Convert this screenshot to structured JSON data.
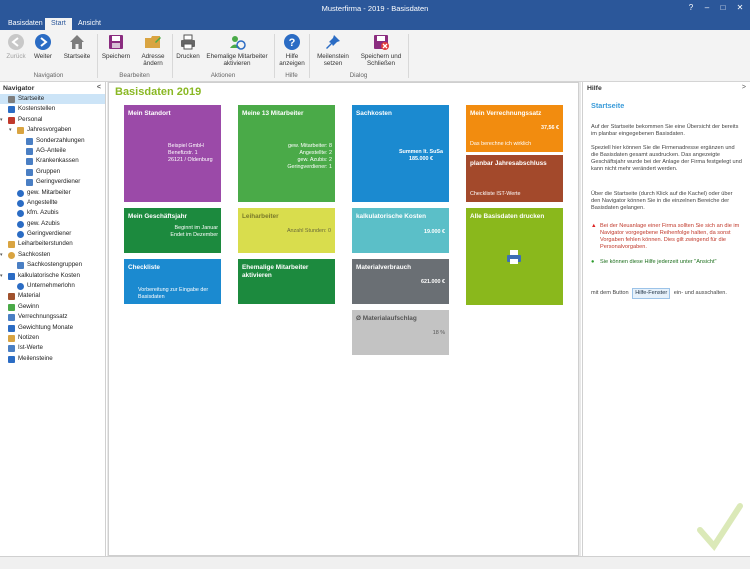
{
  "window": {
    "title": "Musterfirma - 2019 - Basisdaten",
    "help_btn": "?",
    "minimize": "–",
    "maximize": "□",
    "close": "✕"
  },
  "tabs": [
    "Basisdaten",
    "Start",
    "Ansicht"
  ],
  "ribbon": {
    "buttons": {
      "back": "Zurück",
      "forward": "Weiter",
      "home": "Startseite",
      "save": "Speichern",
      "address": "Adresse ändern",
      "print": "Drucken",
      "former": "Ehemalige Mitarbeiter aktivieren",
      "help": "Hilfe anzeigen",
      "milestone": "Meilenstein setzen",
      "saveclose": "Speichern und Schließen"
    },
    "groups": {
      "navigation": "Navigation",
      "edit": "Bearbeiten",
      "actions": "Aktionen",
      "help": "Hilfe",
      "dialog": "Dialog"
    }
  },
  "navigator": {
    "title": "Navigator",
    "collapse": "<",
    "items": [
      {
        "label": "Startseite",
        "icon": "home-icon",
        "level": 0,
        "selected": true
      },
      {
        "label": "Kostenstellen",
        "icon": "list-icon",
        "level": 0
      },
      {
        "label": "Personal",
        "icon": "group-icon",
        "level": 0,
        "expanded": true
      },
      {
        "label": "Jahresvorgaben",
        "icon": "folder-icon",
        "level": 1,
        "expanded": true
      },
      {
        "label": "Sonderzahlungen",
        "icon": "doc-icon",
        "level": 2
      },
      {
        "label": "AG-Anteile",
        "icon": "doc-icon",
        "level": 2
      },
      {
        "label": "Krankenkassen",
        "icon": "doc-icon",
        "level": 2
      },
      {
        "label": "Gruppen",
        "icon": "doc-icon",
        "level": 2
      },
      {
        "label": "Geringverdiener",
        "icon": "doc-icon",
        "level": 2
      },
      {
        "label": "gew. Mitarbeiter",
        "icon": "person-icon",
        "level": 1
      },
      {
        "label": "Angestellte",
        "icon": "person-icon",
        "level": 1
      },
      {
        "label": "kfm. Azubis",
        "icon": "person-icon",
        "level": 1
      },
      {
        "label": "gew. Azubis",
        "icon": "person-icon",
        "level": 1
      },
      {
        "label": "Geringverdiener",
        "icon": "person-icon",
        "level": 1
      },
      {
        "label": "Leiharbeiterstunden",
        "icon": "clock-icon",
        "level": 0
      },
      {
        "label": "Sachkosten",
        "icon": "coins-icon",
        "level": 0,
        "expanded": true
      },
      {
        "label": "Sachkostengruppen",
        "icon": "doc-icon",
        "level": 1
      },
      {
        "label": "kalkulatorische Kosten",
        "icon": "calc-icon",
        "level": 0,
        "expanded": true
      },
      {
        "label": "Unternehmerlohn",
        "icon": "person-icon",
        "level": 1
      },
      {
        "label": "Material",
        "icon": "box-icon",
        "level": 0
      },
      {
        "label": "Gewinn",
        "icon": "chart-icon",
        "level": 0
      },
      {
        "label": "Verrechnungssatz",
        "icon": "doc-icon",
        "level": 0
      },
      {
        "label": "Gewichtung Monate",
        "icon": "calendar-icon",
        "level": 0
      },
      {
        "label": "Notizen",
        "icon": "note-icon",
        "level": 0
      },
      {
        "label": "Ist-Werte",
        "icon": "doc-icon",
        "level": 0
      },
      {
        "label": "Meilensteine",
        "icon": "pin-icon",
        "level": 0
      }
    ]
  },
  "main": {
    "title": "Basisdaten 2019",
    "tiles": {
      "standort": {
        "title": "Mein Standort",
        "lines": [
          "Beispiel GmbH",
          "Benefizstr. 1",
          "26121 / Oldenburg"
        ],
        "color": "#9b4aa8"
      },
      "mitarbeiter": {
        "title": "Meine 13 Mitarbeiter",
        "lines": [
          "gew. Mitarbeiter: 8",
          "Angestellte: 2",
          "gew. Azubis: 2",
          "Geringverdiener: 1"
        ],
        "color": "#4aaa48"
      },
      "sachkosten": {
        "title": "Sachkosten",
        "lines": [
          "Summen lt. SuSa",
          "185.000 €"
        ],
        "color": "#1b8ad0"
      },
      "verrechnung": {
        "title": "Mein Verrechnungssatz",
        "value": "37,56 €",
        "note": "Das berechne ich wirklich",
        "color": "#f28c0f"
      },
      "jahresabschluss": {
        "title": "planbar Jahresabschluss",
        "note": "Checkliste IST-Werte",
        "color": "#a3492b"
      },
      "geschaeftsjahr": {
        "title": "Mein Geschäftsjahr",
        "lines": [
          "Beginnt im Januar",
          "Endet im Dezember"
        ],
        "color": "#1c8a3e"
      },
      "leiharbeiter": {
        "title": "Leiharbeiter",
        "value": "Anzahl Stunden: 0",
        "color": "#d9dd4d"
      },
      "kalk": {
        "title": "kalkulatorische Kosten",
        "value": "19.000 €",
        "color": "#5bbfc8"
      },
      "alle": {
        "title": "Alle Basisdaten drucken",
        "color": "#8ab81c"
      },
      "checkliste": {
        "title": "Checkliste",
        "note": "Vorbereitung zur Eingabe der Basisdaten",
        "color": "#1b8ad0"
      },
      "ehemalige": {
        "title": "Ehemalige Mitarbeiter aktivieren",
        "color": "#1c8a3e"
      },
      "material": {
        "title": "Materialverbrauch",
        "value": "621.000 €",
        "color": "#6a6f74"
      },
      "aufschlag": {
        "title": "Ø Materialaufschlag",
        "value": "18 %",
        "color": "#c3c3c3"
      }
    }
  },
  "help": {
    "title": "Hilfe",
    "collapse": ">",
    "heading": "Startseite",
    "p1": "Auf der Startseite bekommen Sie eine Übersicht der bereits im planbar eingegebenen Basisdaten.",
    "p2": "Speziell hier können Sie die Firmenadresse ergänzen und die Basisdaten gesamt ausdrucken. Das angezeigte Geschäftsjahr wurde bei der Anlage der Firma festgelegt und kann nicht mehr verändert werden.",
    "p3": "Über die Startseite (durch Klick auf die Kachel) oder über den Navigator können Sie in die einzelnen Bereiche der Basisdaten gelangen.",
    "warning": "Bei der Neuanlage einer Firma sollten Sie sich an die im Navigator vorgegebene Reihenfolge halten, da sonst Vorgaben fehlen können. Dies gilt zwingend für die Personalvorgaben.",
    "info": "Sie können diese Hilfe jederzeit unter \"Ansicht\"",
    "info2a": "mit dem Button",
    "info_button": "Hilfe-Fenster",
    "info2b": "ein- und ausschalten."
  },
  "colors": {
    "accent": "#2b579a",
    "title_green": "#8ab824",
    "help_blue": "#3a9bd9"
  }
}
